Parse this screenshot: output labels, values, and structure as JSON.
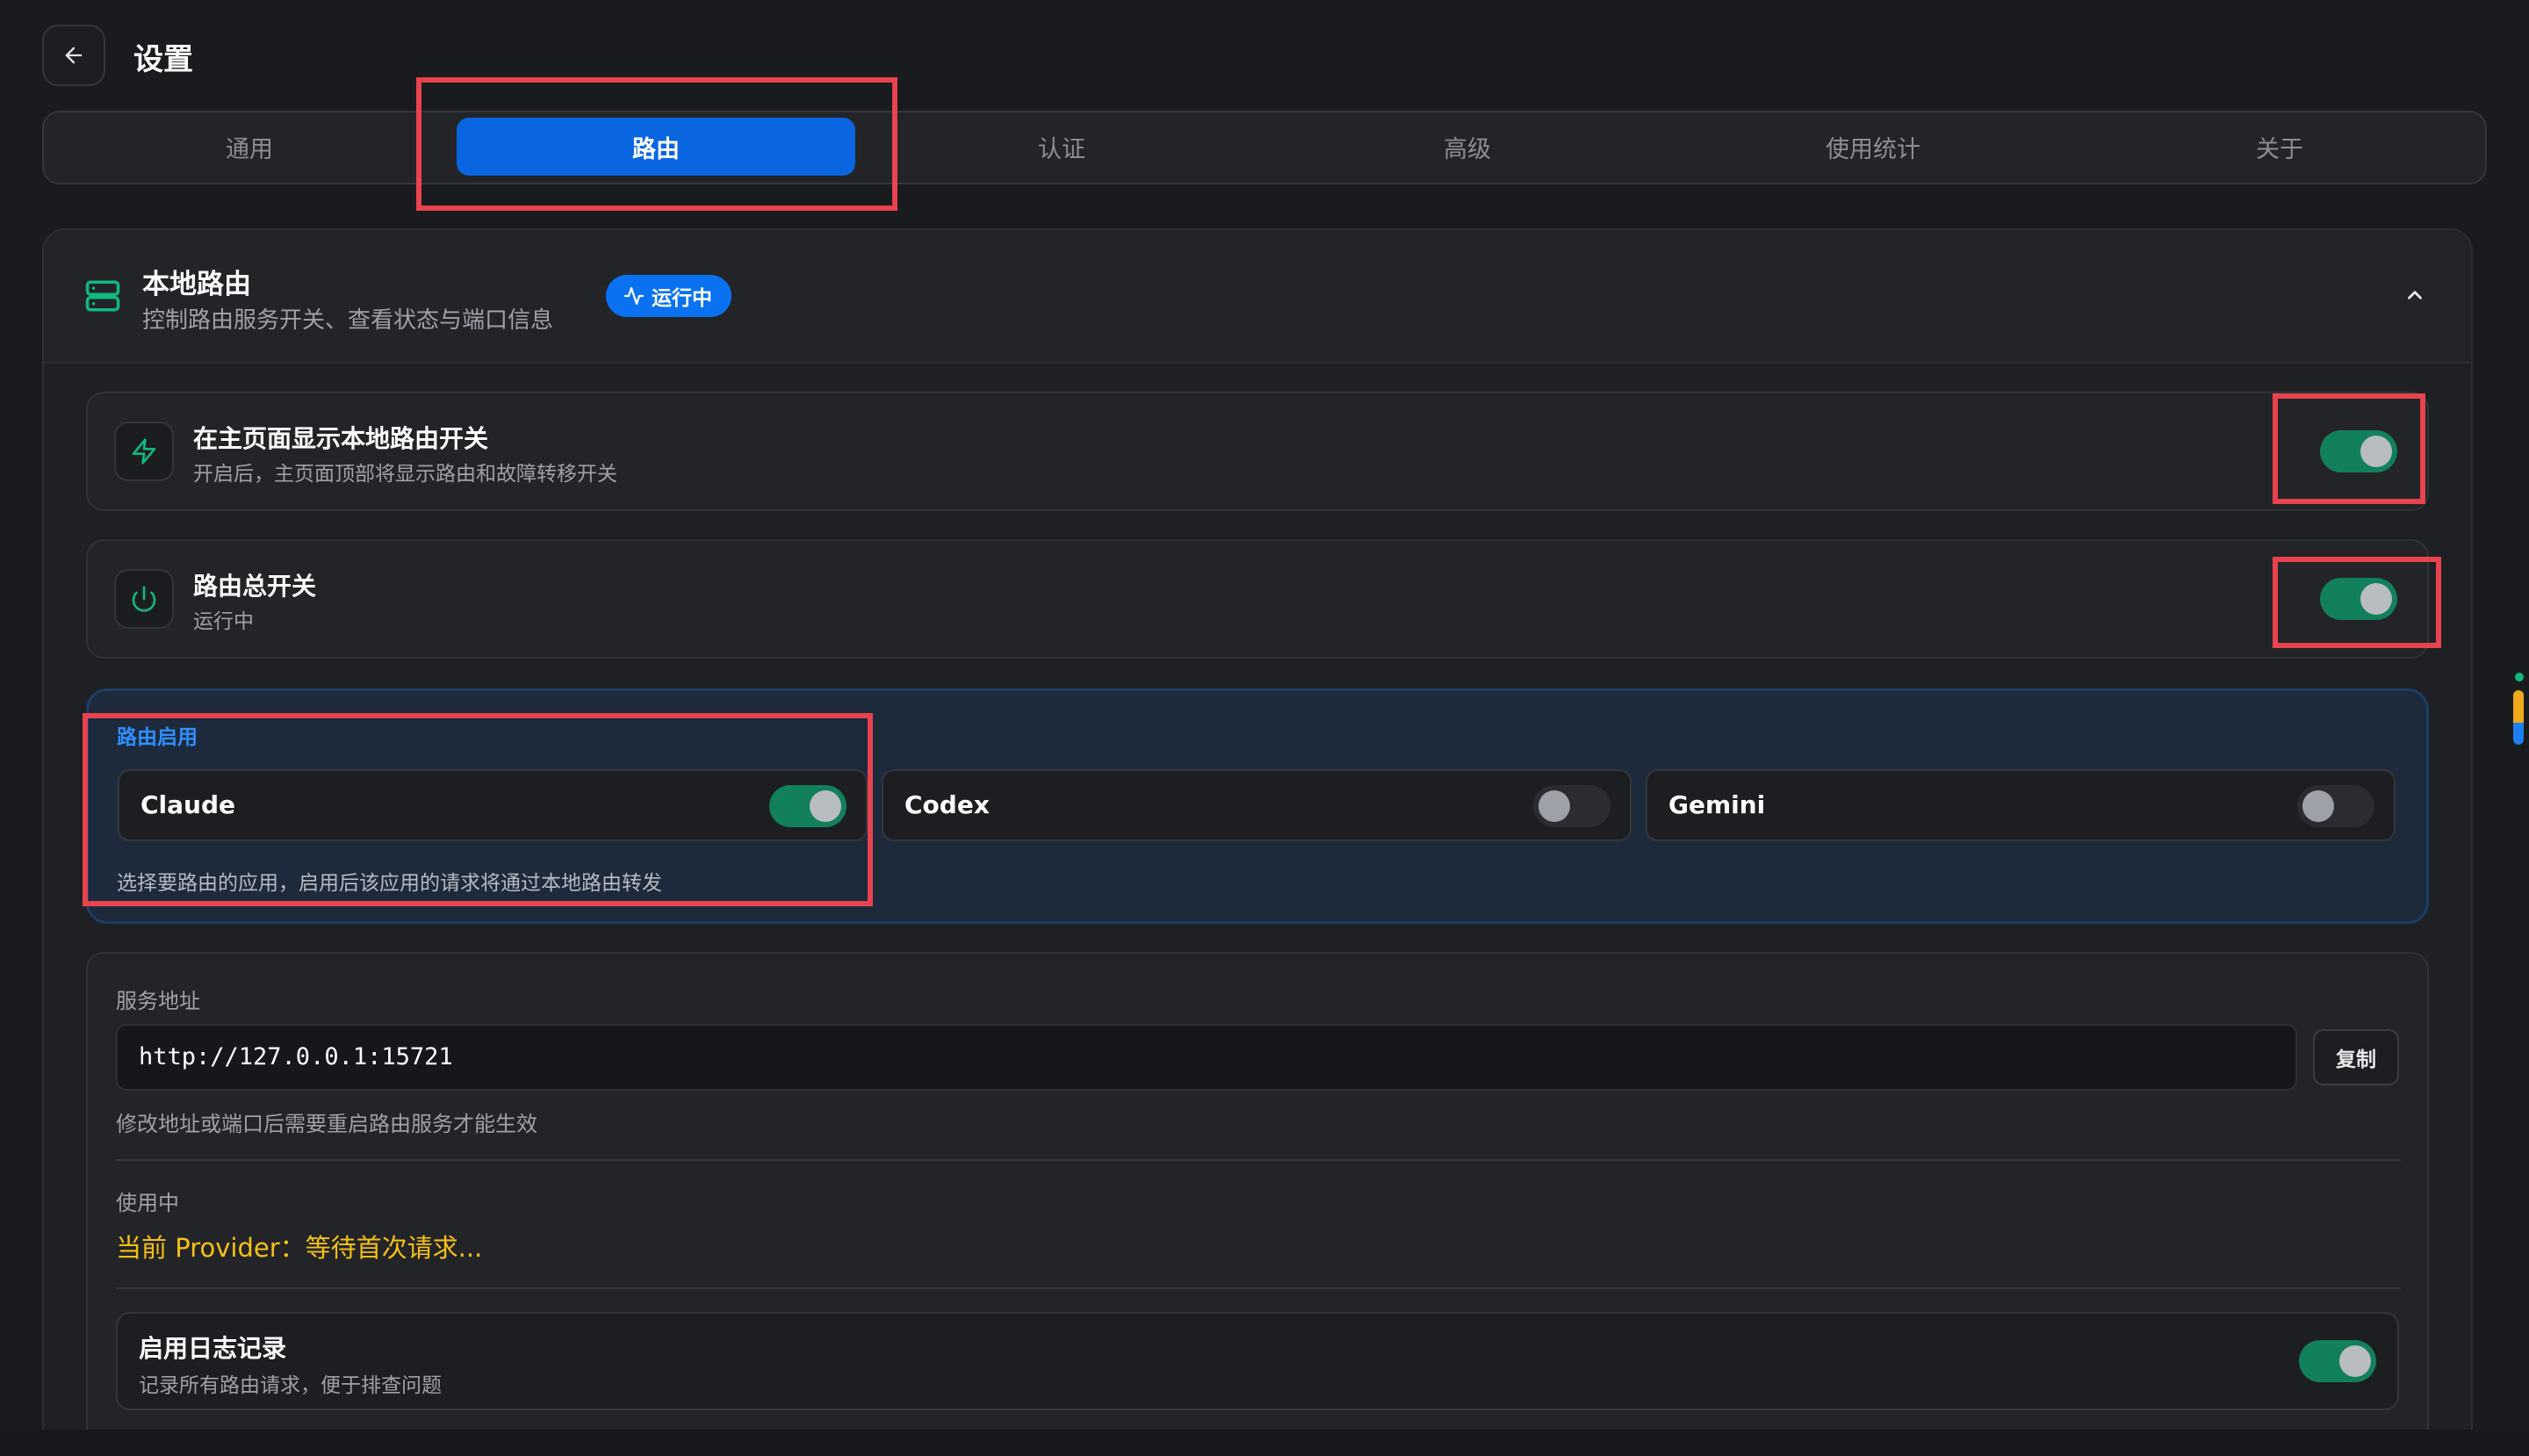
{
  "header": {
    "title": "设置"
  },
  "tabs": [
    {
      "label": "通用"
    },
    {
      "label": "路由"
    },
    {
      "label": "认证"
    },
    {
      "label": "高级"
    },
    {
      "label": "使用统计"
    },
    {
      "label": "关于"
    }
  ],
  "active_tab": "路由",
  "section": {
    "title": "本地路由",
    "subtitle": "控制路由服务开关、查看状态与端口信息",
    "badge": "运行中"
  },
  "rows": {
    "show_switch": {
      "title": "在主页面显示本地路由开关",
      "subtitle": "开启后，主页面顶部将显示路由和故障转移开关",
      "enabled": true
    },
    "master_switch": {
      "title": "路由总开关",
      "subtitle": "运行中",
      "enabled": true
    }
  },
  "apps": {
    "label": "路由启用",
    "hint": "选择要路由的应用，启用后该应用的请求将通过本地路由转发",
    "items": [
      {
        "name": "Claude",
        "enabled": true
      },
      {
        "name": "Codex",
        "enabled": false
      },
      {
        "name": "Gemini",
        "enabled": false
      }
    ]
  },
  "server": {
    "label": "服务地址",
    "url": "http://127.0.0.1:15721",
    "copy_label": "复制",
    "hint": "修改地址或端口后需要重启路由服务才能生效"
  },
  "usage": {
    "label": "使用中",
    "provider": "当前 Provider：等待首次请求..."
  },
  "logging": {
    "title": "启用日志记录",
    "subtitle": "记录所有路由请求，便于排查问题",
    "enabled": true
  },
  "colors": {
    "accent": "#0a66e0",
    "toggle_on": "#12805a",
    "highlight": "#e8434f",
    "provider_text": "#f5c117",
    "app_label": "#2f8fff"
  }
}
